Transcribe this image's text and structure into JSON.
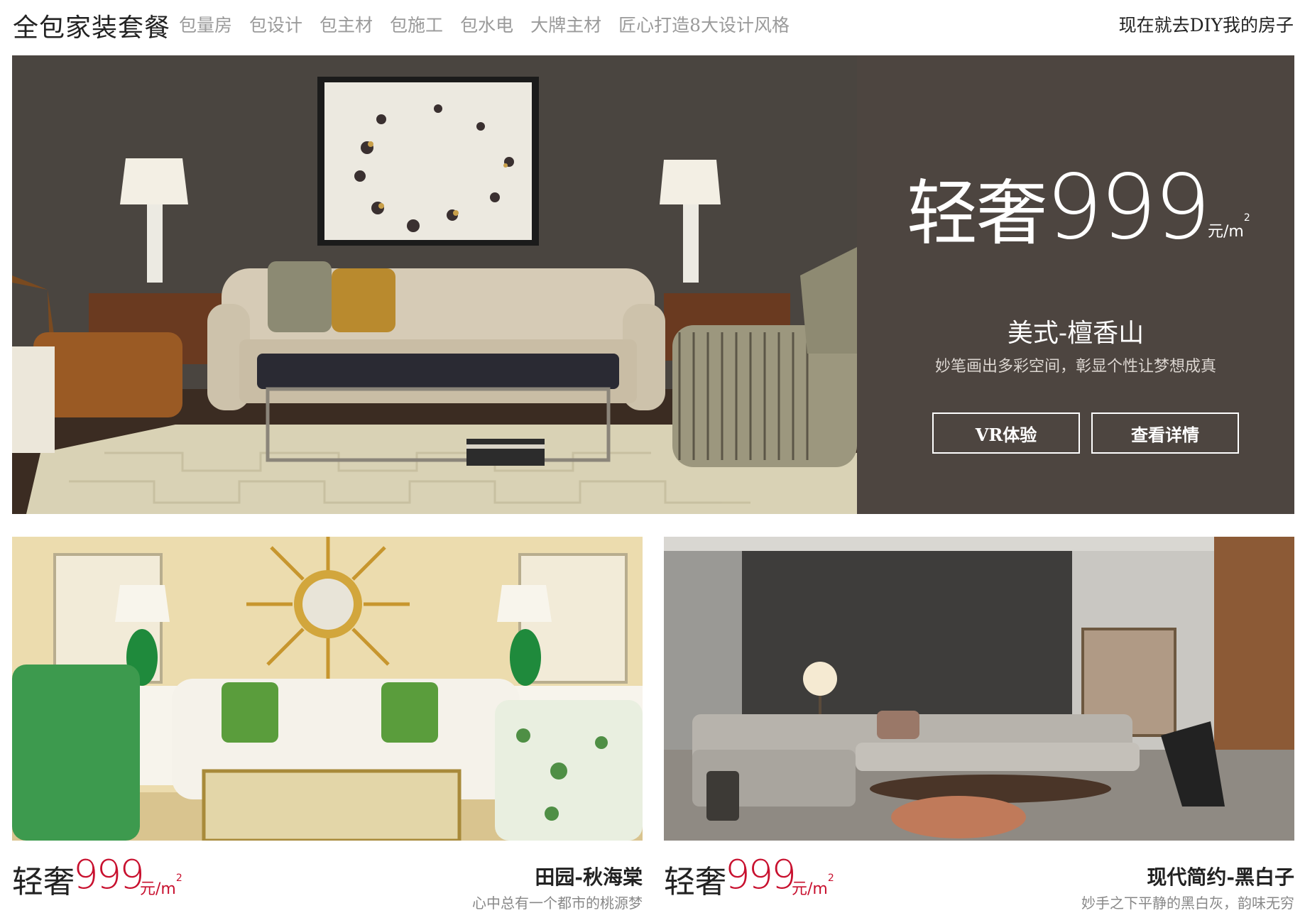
{
  "header": {
    "brand": "全包家装套餐",
    "nav": [
      "包量房",
      "包设计",
      "包主材",
      "包施工",
      "包水电",
      "大牌主材",
      "匠心打造8大设计风格"
    ],
    "diy_link": "现在就去DIY我的房子"
  },
  "hero": {
    "price_prefix": "轻奢",
    "price_number": "999",
    "price_unit": "元/m",
    "price_unit_sup": "2",
    "title": "美式-檀香山",
    "subtitle": "妙笔画出多彩空间，彰显个性让梦想成真",
    "vr_button": "VR体验",
    "detail_button": "查看详情"
  },
  "cards": [
    {
      "price_prefix": "轻奢",
      "price_number": "999",
      "price_unit": "元/m",
      "price_unit_sup": "2",
      "title": "田园-秋海棠",
      "subtitle": "心中总有一个都市的桃源梦"
    },
    {
      "price_prefix": "轻奢",
      "price_number": "999",
      "price_unit": "元/m",
      "price_unit_sup": "2",
      "title": "现代简约-黑白子",
      "subtitle": "妙手之下平静的黑白灰，韵味无穷"
    }
  ],
  "colors": {
    "accent_red": "#c8102e",
    "hero_panel": "#4d4540",
    "nav_gray": "#9a9a9a"
  }
}
